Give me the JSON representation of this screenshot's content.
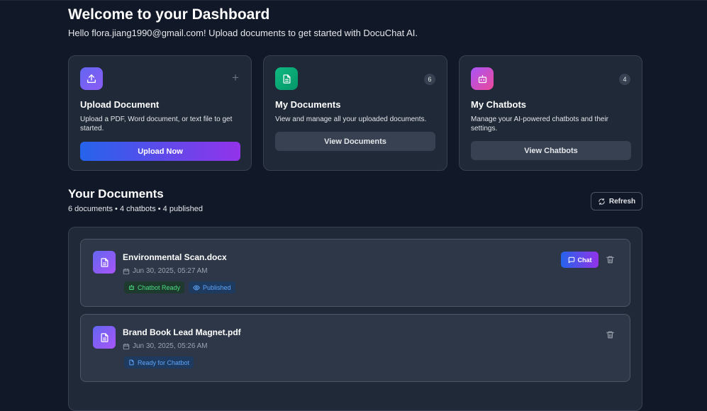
{
  "header": {
    "title": "Welcome to your Dashboard",
    "subtitle": "Hello flora.jiang1990@gmail.com! Upload documents to get started with DocuChat AI."
  },
  "cards": [
    {
      "icon": "upload-icon",
      "title": "Upload Document",
      "description": "Upload a PDF, Word document, or text file to get started.",
      "button": "Upload Now",
      "corner": "+"
    },
    {
      "icon": "document-icon",
      "title": "My Documents",
      "description": "View and manage all your uploaded documents.",
      "button": "View Documents",
      "badge": "6"
    },
    {
      "icon": "bot-icon",
      "title": "My Chatbots",
      "description": "Manage your AI-powered chatbots and their settings.",
      "button": "View Chatbots",
      "badge": "4"
    }
  ],
  "documents_section": {
    "title": "Your Documents",
    "stats": "6 documents • 4 chatbots • 4 published",
    "refresh_label": "Refresh"
  },
  "documents": [
    {
      "name": "Environmental Scan.docx",
      "date": "Jun 30, 2025, 05:27 AM",
      "tags": [
        "Chatbot Ready",
        "Published"
      ],
      "chat_label": "Chat"
    },
    {
      "name": "Brand Book Lead Magnet.pdf",
      "date": "Jun 30, 2025, 05:26 AM",
      "tags": [
        "Ready for Chatbot"
      ]
    }
  ],
  "colors": {
    "background": "#111827",
    "card": "#1f2937",
    "accent_start": "#2563eb",
    "accent_end": "#9333ea",
    "tag_green": "#4ade80",
    "tag_blue": "#60a5fa"
  }
}
